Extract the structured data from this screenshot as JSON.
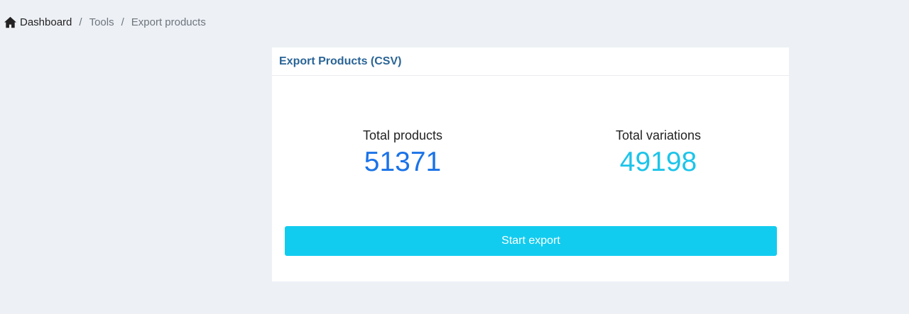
{
  "breadcrumb": {
    "home_icon": "home-icon",
    "items": [
      {
        "label": "Dashboard"
      },
      {
        "label": "Tools"
      },
      {
        "label": "Export products"
      }
    ],
    "separator": "/"
  },
  "card": {
    "title": "Export Products (CSV)",
    "stats": [
      {
        "label": "Total products",
        "value": "51371",
        "color": "#1a73e8"
      },
      {
        "label": "Total variations",
        "value": "49198",
        "color": "#1dc4e9"
      }
    ],
    "button_label": "Start export",
    "button_color": "#12ccef"
  },
  "colors": {
    "background": "#edf0f5",
    "title": "#2a6496"
  }
}
